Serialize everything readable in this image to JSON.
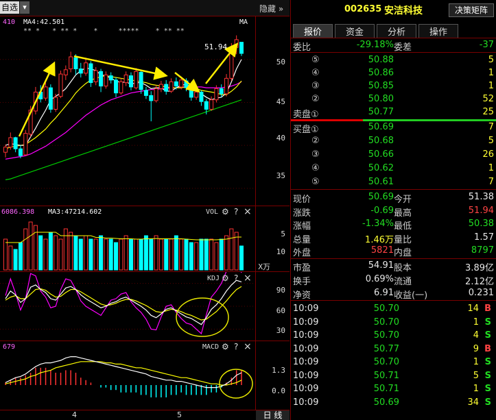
{
  "header": {
    "watchlist_label": "自选",
    "dropdown": "▾",
    "hide_label": "隐藏",
    "hide_arrow": "»"
  },
  "stock": {
    "code": "002635",
    "name": "安洁科技",
    "decision_btn": "决策矩阵"
  },
  "tabs": [
    {
      "label": "报价"
    },
    {
      "label": "资金"
    },
    {
      "label": "分析"
    },
    {
      "label": "操作"
    }
  ],
  "main_chart": {
    "ma_left": "410",
    "ma4": "MA4:42.501",
    "ma_label": "MA",
    "marks": "** *   * ** *    *     *****    * ** **",
    "high_label": "51.94",
    "y_ticks": [
      "50",
      "45",
      "40",
      "35"
    ]
  },
  "vol_panel": {
    "left_val": "6086.398",
    "ma3": "MA3:47214.602",
    "name": "VOL",
    "y_ticks": [
      "10",
      "5"
    ],
    "unit": "X万"
  },
  "kdj_panel": {
    "name": "KDJ",
    "y_ticks": [
      "90",
      "60",
      "30"
    ]
  },
  "macd_panel": {
    "left_val": "679",
    "name": "MACD",
    "y_ticks": [
      "1.3",
      "0.0"
    ]
  },
  "x_axis": {
    "labels": [
      "4",
      "5"
    ],
    "period_btn": "日 线"
  },
  "panel_icons": {
    "gear": "⚙",
    "help": "?",
    "close": "×"
  },
  "quote": {
    "weibi_label": "委比",
    "weibi": "-29.18%",
    "weicha_label": "委差",
    "weicha": "-37",
    "asks": [
      {
        "label": "⑤",
        "price": "50.88",
        "vol": "5"
      },
      {
        "label": "④",
        "price": "50.86",
        "vol": "1"
      },
      {
        "label": "③",
        "price": "50.85",
        "vol": "1"
      },
      {
        "label": "②",
        "price": "50.80",
        "vol": "52"
      },
      {
        "label": "卖盘①",
        "price": "50.77",
        "vol": "25"
      }
    ],
    "bids": [
      {
        "label": "买盘①",
        "price": "50.69",
        "vol": "7"
      },
      {
        "label": "②",
        "price": "50.68",
        "vol": "5"
      },
      {
        "label": "③",
        "price": "50.66",
        "vol": "26"
      },
      {
        "label": "④",
        "price": "50.62",
        "vol": "1"
      },
      {
        "label": "⑤",
        "price": "50.61",
        "vol": "7"
      }
    ],
    "stats": [
      {
        "l1": "现价",
        "v1": "50.69",
        "c1": "g",
        "l2": "今开",
        "v2": "51.38",
        "c2": "w"
      },
      {
        "l1": "涨跌",
        "v1": "-0.69",
        "c1": "g",
        "l2": "最高",
        "v2": "51.94",
        "c2": "r"
      },
      {
        "l1": "涨幅",
        "v1": "-1.34%",
        "c1": "g",
        "l2": "最低",
        "v2": "50.38",
        "c2": "g"
      },
      {
        "l1": "总量",
        "v1": "1.46万",
        "c1": "y",
        "l2": "量比",
        "v2": "1.57",
        "c2": "w"
      },
      {
        "l1": "外盘",
        "v1": "5821",
        "c1": "r",
        "l2": "内盘",
        "v2": "8797",
        "c2": "g"
      }
    ],
    "fund": [
      {
        "l1": "市盈",
        "v1": "54.91",
        "l2": "股本",
        "v2": "3.89亿"
      },
      {
        "l1": "换手",
        "v1": "0.69%",
        "l2": "流通",
        "v2": "2.12亿"
      },
      {
        "l1": "净资",
        "v1": "6.91",
        "l2": "收益(一)",
        "v2": "0.231"
      }
    ],
    "trades": [
      {
        "time": "10:09",
        "price": "50.70",
        "vol": "14",
        "side": "B"
      },
      {
        "time": "10:09",
        "price": "50.70",
        "vol": "1",
        "side": "S"
      },
      {
        "time": "10:09",
        "price": "50.70",
        "vol": "4",
        "side": "S"
      },
      {
        "time": "10:09",
        "price": "50.77",
        "vol": "9",
        "side": "B"
      },
      {
        "time": "10:09",
        "price": "50.70",
        "vol": "1",
        "side": "S"
      },
      {
        "time": "10:09",
        "price": "50.71",
        "vol": "5",
        "side": "S"
      },
      {
        "time": "10:09",
        "price": "50.71",
        "vol": "1",
        "side": "S"
      },
      {
        "time": "10:09",
        "price": "50.69",
        "vol": "34",
        "side": "S"
      }
    ]
  },
  "colors": {
    "up": "#ff3333",
    "down": "#00ffff",
    "ma5": "#ffffff",
    "ma10": "#ffff00",
    "ma20": "#ff00ff",
    "ma60": "#00cc00",
    "arrow": "#ffee00",
    "circle": "#e8e800"
  },
  "chart_data": {
    "type": "candlestick",
    "candles": [
      [
        39.2,
        39.8,
        38.6,
        40.1
      ],
      [
        39.8,
        40.9,
        39.5,
        41.5
      ],
      [
        40.9,
        39.6,
        39.2,
        41.0
      ],
      [
        39.6,
        38.8,
        38.5,
        40.0
      ],
      [
        38.9,
        41.4,
        38.8,
        41.8
      ],
      [
        41.3,
        44.1,
        41.0,
        44.6
      ],
      [
        44.0,
        46.2,
        43.6,
        46.8
      ],
      [
        46.2,
        45.4,
        45.0,
        47.0
      ],
      [
        45.5,
        46.8,
        45.2,
        47.3
      ],
      [
        46.7,
        44.2,
        43.8,
        47.1
      ],
      [
        44.2,
        45.6,
        43.9,
        46.0
      ],
      [
        45.7,
        48.3,
        45.5,
        48.7
      ],
      [
        48.2,
        48.8,
        47.6,
        49.3
      ],
      [
        48.9,
        50.3,
        48.5,
        50.9
      ],
      [
        50.2,
        48.9,
        48.2,
        50.6
      ],
      [
        48.9,
        48.4,
        47.9,
        49.6
      ],
      [
        48.4,
        49.6,
        48.1,
        50.2
      ],
      [
        49.5,
        47.3,
        46.8,
        49.8
      ],
      [
        47.4,
        48.7,
        47.0,
        49.1
      ],
      [
        48.6,
        46.9,
        46.2,
        48.9
      ],
      [
        46.9,
        48.2,
        46.6,
        48.6
      ],
      [
        48.1,
        47.6,
        47.2,
        48.5
      ],
      [
        47.6,
        46.1,
        45.6,
        47.9
      ],
      [
        46.1,
        47.4,
        45.9,
        47.8
      ],
      [
        47.3,
        48.2,
        46.9,
        48.6
      ],
      [
        48.1,
        46.8,
        46.4,
        48.5
      ],
      [
        46.7,
        48.6,
        46.5,
        49.0
      ],
      [
        48.5,
        46.5,
        46.0,
        48.7
      ],
      [
        46.4,
        45.8,
        45.4,
        46.8
      ],
      [
        45.8,
        45.2,
        42.8,
        46.3
      ],
      [
        45.2,
        46.6,
        45.0,
        47.0
      ],
      [
        46.6,
        47.1,
        46.2,
        47.5
      ],
      [
        47.1,
        46.3,
        45.9,
        47.6
      ],
      [
        46.3,
        47.4,
        46.1,
        47.8
      ],
      [
        47.4,
        46.9,
        46.5,
        47.9
      ],
      [
        46.8,
        47.6,
        46.5,
        48.0
      ],
      [
        47.5,
        46.7,
        46.3,
        47.8
      ],
      [
        46.7,
        45.6,
        45.2,
        46.9
      ],
      [
        45.6,
        46.2,
        45.3,
        46.6
      ],
      [
        46.2,
        45.1,
        44.6,
        46.4
      ],
      [
        45.1,
        44.2,
        43.6,
        45.4
      ],
      [
        44.2,
        45.3,
        44.0,
        45.7
      ],
      [
        45.3,
        46.6,
        45.0,
        47.0
      ],
      [
        46.6,
        46.0,
        45.6,
        47.1
      ],
      [
        46.0,
        47.8,
        45.7,
        48.3
      ],
      [
        47.8,
        51.4,
        47.5,
        51.9
      ],
      [
        51.4,
        52.3,
        50.6,
        52.8
      ],
      [
        52.0,
        50.7,
        50.4,
        51.94
      ]
    ],
    "ma5": [
      40.0,
      40.2,
      40.1,
      40.0,
      40.0,
      41.0,
      42.0,
      43.1,
      44.1,
      45.3,
      45.7,
      46.1,
      46.6,
      47.4,
      48.2,
      48.7,
      49.0,
      48.9,
      48.7,
      48.2,
      48.1,
      47.8,
      47.5,
      47.3,
      47.4,
      47.1,
      47.3,
      47.3,
      47.0,
      46.6,
      46.7,
      46.7,
      46.3,
      46.3,
      46.7,
      47.0,
      47.1,
      46.8,
      46.5,
      46.0,
      45.6,
      45.3,
      45.5,
      45.6,
      46.1,
      47.4,
      48.9,
      50.0
    ],
    "ma10": [
      39.6,
      39.8,
      39.9,
      40.0,
      40.1,
      40.5,
      40.9,
      41.4,
      41.9,
      42.6,
      43.2,
      43.9,
      44.6,
      45.3,
      46.1,
      46.7,
      47.2,
      47.6,
      47.8,
      48.0,
      48.1,
      48.0,
      47.9,
      47.8,
      47.7,
      47.6,
      47.5,
      47.4,
      47.3,
      47.1,
      47.0,
      46.9,
      46.8,
      46.7,
      46.7,
      46.7,
      46.8,
      46.7,
      46.6,
      46.4,
      46.3,
      46.2,
      46.1,
      45.9,
      45.9,
      46.3,
      46.8,
      47.5
    ],
    "ma20": [
      38.4,
      38.5,
      38.6,
      38.7,
      38.8,
      39.0,
      39.3,
      39.6,
      39.9,
      40.3,
      40.7,
      41.1,
      41.5,
      42.0,
      42.5,
      43.0,
      43.5,
      43.9,
      44.3,
      44.7,
      45.0,
      45.3,
      45.5,
      45.7,
      45.9,
      46.1,
      46.2,
      46.3,
      46.4,
      46.5,
      46.5,
      46.6,
      46.6,
      46.7,
      46.7,
      46.8,
      46.8,
      46.8,
      46.8,
      46.8,
      46.7,
      46.7,
      46.7,
      46.7,
      46.8,
      46.9,
      47.1,
      47.4
    ],
    "ma60": [
      36.0,
      36.1,
      36.3,
      36.5,
      36.7,
      36.9,
      37.1,
      37.3,
      37.5,
      37.7,
      37.9,
      38.1,
      38.3,
      38.5,
      38.7,
      38.9,
      39.1,
      39.3,
      39.5,
      39.7,
      39.9,
      40.1,
      40.3,
      40.5,
      40.7,
      40.9,
      41.1,
      41.3,
      41.5,
      41.7,
      41.9,
      42.1,
      42.3,
      42.5,
      42.7,
      42.9,
      43.1,
      43.3,
      43.5,
      43.7,
      43.9,
      44.1,
      44.3,
      44.5,
      44.7,
      44.9,
      45.1,
      45.3
    ],
    "price_range": [
      33,
      55
    ],
    "volume": [
      9,
      7,
      6,
      8,
      12,
      14,
      13,
      10,
      9,
      11,
      10,
      9,
      12,
      11,
      10,
      9,
      10,
      9,
      9,
      10,
      9,
      9,
      8,
      9,
      10,
      9,
      9,
      9,
      10,
      9,
      10,
      9,
      9,
      9,
      10,
      9,
      9,
      8,
      8,
      9,
      9,
      9,
      8,
      9,
      10,
      12,
      11,
      7
    ],
    "vol_ma": [
      8,
      8,
      8,
      8,
      9,
      10,
      11,
      11,
      11,
      11,
      11,
      10,
      10,
      10,
      10,
      10,
      10,
      10,
      9.5,
      9.5,
      9.3,
      9.3,
      9.2,
      9.1,
      9.1,
      9.1,
      9.0,
      9.0,
      9.1,
      9.1,
      9.2,
      9.1,
      9.1,
      9.1,
      9.1,
      9.1,
      9.0,
      8.9,
      8.8,
      8.8,
      8.8,
      8.8,
      8.8,
      8.9,
      9.0,
      9.3,
      9.6,
      9.6
    ],
    "vol_range": [
      0,
      15
    ],
    "kdj_k": [
      70,
      80,
      75,
      65,
      70,
      85,
      88,
      82,
      78,
      70,
      68,
      76,
      84,
      86,
      82,
      75,
      70,
      66,
      62,
      58,
      60,
      64,
      66,
      70,
      72,
      68,
      64,
      60,
      55,
      48,
      45,
      50,
      56,
      58,
      54,
      50,
      46,
      44,
      40,
      36,
      45,
      56,
      62,
      70,
      80,
      88,
      94,
      92
    ],
    "kdj_d": [
      68,
      72,
      74,
      70,
      70,
      76,
      82,
      83,
      81,
      76,
      72,
      73,
      78,
      82,
      82,
      79,
      75,
      71,
      67,
      63,
      61,
      62,
      64,
      67,
      69,
      69,
      67,
      64,
      61,
      57,
      53,
      52,
      54,
      56,
      55,
      53,
      50,
      48,
      45,
      42,
      43,
      48,
      53,
      60,
      67,
      75,
      82,
      86
    ],
    "kdj_j": [
      74,
      96,
      77,
      55,
      70,
      103,
      100,
      80,
      72,
      58,
      60,
      82,
      96,
      94,
      82,
      67,
      60,
      56,
      52,
      48,
      58,
      68,
      70,
      76,
      78,
      66,
      58,
      52,
      43,
      30,
      29,
      46,
      60,
      62,
      52,
      44,
      38,
      36,
      30,
      24,
      49,
      72,
      80,
      90,
      106,
      114,
      118,
      104
    ],
    "kdj_range": [
      15,
      105
    ],
    "macd_dif": [
      0.2,
      0.4,
      0.6,
      0.7,
      0.9,
      1.2,
      1.5,
      1.7,
      1.8,
      1.8,
      1.9,
      2.0,
      2.2,
      2.3,
      2.3,
      2.2,
      2.1,
      2.0,
      1.9,
      1.8,
      1.7,
      1.6,
      1.5,
      1.4,
      1.3,
      1.2,
      1.1,
      1.0,
      0.9,
      0.7,
      0.6,
      0.5,
      0.4,
      0.4,
      0.3,
      0.3,
      0.2,
      0.1,
      0.0,
      -0.1,
      -0.2,
      -0.2,
      -0.2,
      -0.1,
      0.1,
      0.4,
      0.8,
      1.0
    ],
    "macd_dea": [
      0.1,
      0.2,
      0.3,
      0.4,
      0.5,
      0.7,
      0.8,
      1.0,
      1.1,
      1.2,
      1.4,
      1.5,
      1.6,
      1.7,
      1.8,
      1.9,
      1.9,
      1.9,
      1.9,
      1.9,
      1.8,
      1.8,
      1.7,
      1.7,
      1.6,
      1.5,
      1.4,
      1.4,
      1.3,
      1.2,
      1.1,
      1.0,
      0.9,
      0.8,
      0.7,
      0.6,
      0.6,
      0.5,
      0.4,
      0.3,
      0.2,
      0.1,
      0.1,
      0.0,
      0.0,
      0.1,
      0.2,
      0.4
    ],
    "macd_range": [
      -2.0,
      3.0
    ]
  }
}
